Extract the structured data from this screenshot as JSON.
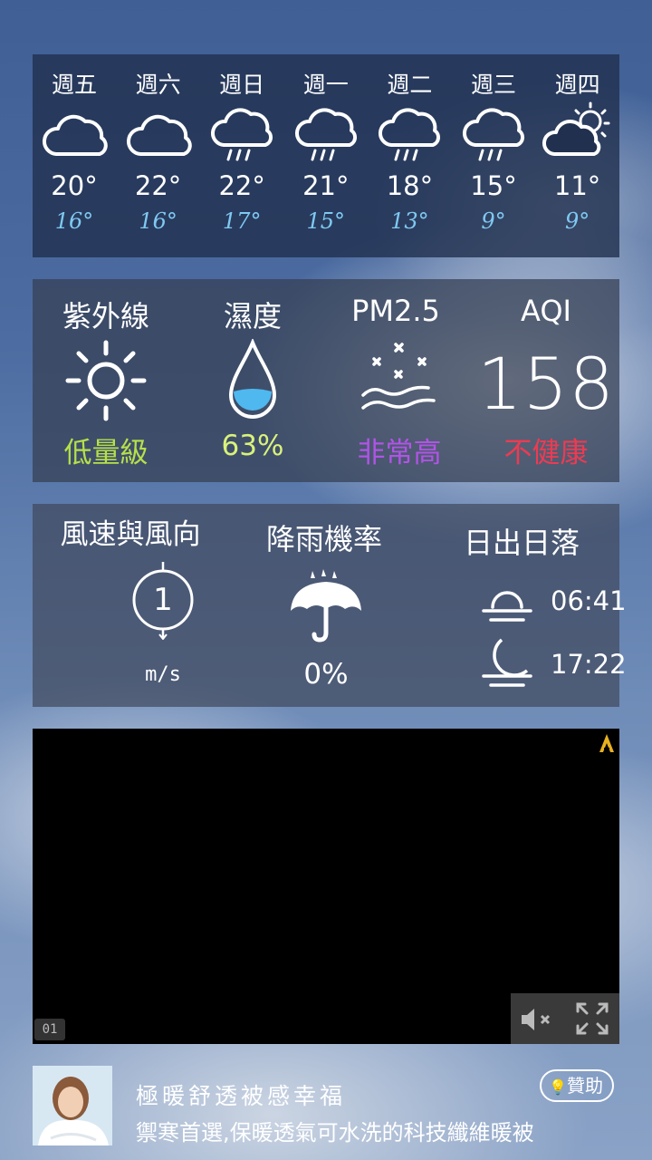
{
  "forecast": [
    {
      "day": "週五",
      "hi": "20°",
      "lo": "16°",
      "icon": "cloudy-icon"
    },
    {
      "day": "週六",
      "hi": "22°",
      "lo": "16°",
      "icon": "cloudy-icon"
    },
    {
      "day": "週日",
      "hi": "22°",
      "lo": "17°",
      "icon": "rain-icon"
    },
    {
      "day": "週一",
      "hi": "21°",
      "lo": "15°",
      "icon": "rain-icon"
    },
    {
      "day": "週二",
      "hi": "18°",
      "lo": "13°",
      "icon": "rain-icon"
    },
    {
      "day": "週三",
      "hi": "15°",
      "lo": "9°",
      "icon": "rain-icon"
    },
    {
      "day": "週四",
      "hi": "11°",
      "lo": "9°",
      "icon": "partly-sunny-icon"
    }
  ],
  "conditions": {
    "uv": {
      "title": "紫外線",
      "value": "低量級",
      "color": "#b6e04a"
    },
    "humidity": {
      "title": "濕度",
      "value": "63%",
      "color": "#d9f27a"
    },
    "pm25": {
      "title": "PM2.5",
      "value": "非常高",
      "color": "#b253e8"
    },
    "aqi": {
      "title": "AQI",
      "number": "158",
      "value": "不健康",
      "color": "#ec3b52"
    }
  },
  "details": {
    "wind": {
      "title": "風速與風向",
      "speed": "1",
      "unit": "m/s"
    },
    "rain": {
      "title": "降雨機率",
      "value": "0%"
    },
    "sun": {
      "title": "日出日落",
      "sunrise": "06:41",
      "sunset": "17:22"
    }
  },
  "ad": {
    "counter": "01",
    "banner_title": "極暖舒透被感幸福",
    "banner_subtitle": "禦寒首選,保暖透氣可水洗的科技纖維暖被",
    "sponsor_label": "贊助"
  }
}
